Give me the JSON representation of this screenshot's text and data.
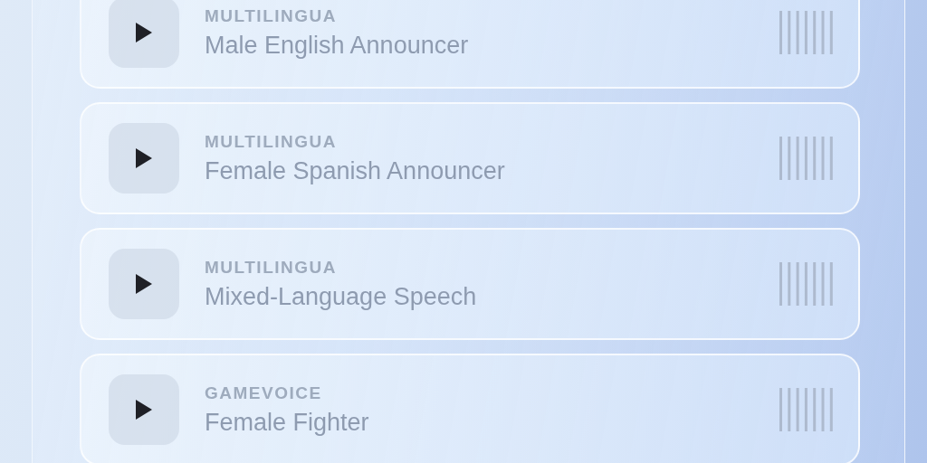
{
  "voices": [
    {
      "category": "MULTILINGUA",
      "title": "Male English Announcer"
    },
    {
      "category": "MULTILINGUA",
      "title": "Female Spanish Announcer"
    },
    {
      "category": "MULTILINGUA",
      "title": "Mixed-Language Speech"
    },
    {
      "category": "GAMEVOICE",
      "title": "Female Fighter"
    }
  ]
}
